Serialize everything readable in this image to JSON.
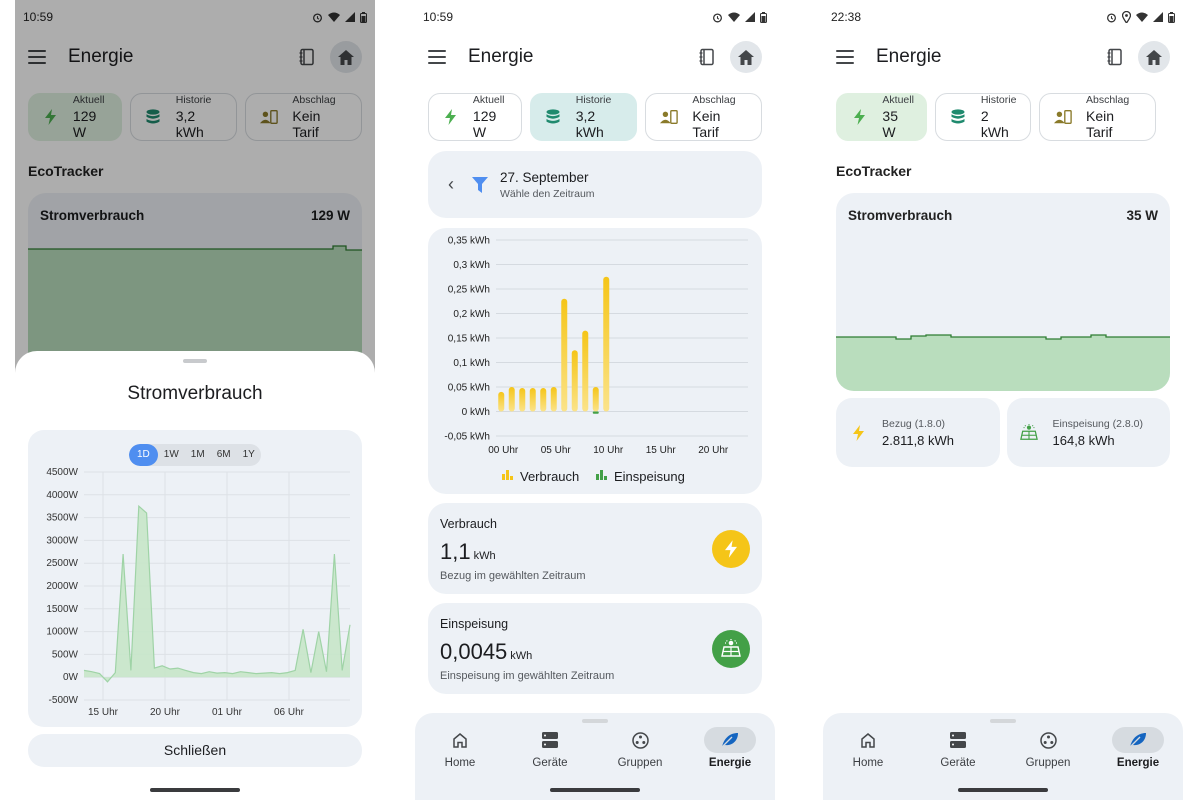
{
  "screens": [
    {
      "status": {
        "time": "10:59"
      },
      "app_title": "Energie",
      "chips": [
        {
          "label": "Aktuell",
          "value": "129 W"
        },
        {
          "label": "Historie",
          "value": "3,2 kWh"
        },
        {
          "label": "Abschlag",
          "value": "Kein Tarif"
        }
      ],
      "section": "EcoTracker",
      "card_title": "Stromverbrauch",
      "card_value": "129 W"
    },
    {
      "status": {
        "time": "10:59"
      },
      "app_title": "Energie",
      "chips": [
        {
          "label": "Aktuell",
          "value": "129 W"
        },
        {
          "label": "Historie",
          "value": "3,2 kWh"
        },
        {
          "label": "Abschlag",
          "value": "Kein Tarif"
        }
      ]
    },
    {
      "status": {
        "time": "22:38"
      },
      "app_title": "Energie",
      "chips": [
        {
          "label": "Aktuell",
          "value": "35 W"
        },
        {
          "label": "Historie",
          "value": "2 kWh"
        },
        {
          "label": "Abschlag",
          "value": "Kein Tarif"
        }
      ],
      "section": "EcoTracker",
      "card_title": "Stromverbrauch",
      "card_value": "35 W"
    }
  ],
  "sheet": {
    "title": "Stromverbrauch",
    "ranges": [
      "1D",
      "1W",
      "1M",
      "6M",
      "1Y"
    ],
    "selected_range": "1D",
    "close_label": "Schließen"
  },
  "history": {
    "date_title": "27. September",
    "date_sub": "Wähle den Zeitraum",
    "verbrauch": {
      "title": "Verbrauch",
      "value": "1,1",
      "unit": "kWh",
      "desc": "Bezug im gewählten Zeitraum"
    },
    "einspeisung": {
      "title": "Einspeisung",
      "value": "0,0045",
      "unit": "kWh",
      "desc": "Einspeisung im gewählten Zeitraum"
    }
  },
  "meters": {
    "bezug": {
      "label": "Bezug (1.8.0)",
      "value": "2.811,8 kWh"
    },
    "einspeisung": {
      "label": "Einspeisung (2.8.0)",
      "value": "164,8 kWh"
    }
  },
  "nav": [
    {
      "label": "Home",
      "icon": "home-icon"
    },
    {
      "label": "Geräte",
      "icon": "devices-icon"
    },
    {
      "label": "Gruppen",
      "icon": "groups-icon"
    },
    {
      "label": "Energie",
      "icon": "leaf-icon",
      "selected": true
    }
  ],
  "colors": {
    "accent_green": "#2e7d32",
    "chart_yellow": "#f5c518",
    "feed_green": "#43a047",
    "selected_blue": "#4f8ef0"
  },
  "chart_data": [
    {
      "type": "line",
      "title": "Stromverbrauch",
      "xlabel": "",
      "ylabel": "",
      "y_ticks": [
        "4500W",
        "4000W",
        "3500W",
        "3000W",
        "2500W",
        "2000W",
        "1500W",
        "1000W",
        "500W",
        "0W",
        "-500W"
      ],
      "x_ticks": [
        "15 Uhr",
        "20 Uhr",
        "01 Uhr",
        "06 Uhr"
      ],
      "ylim": [
        -500,
        4500
      ],
      "series": [
        {
          "values": [
            150,
            120,
            80,
            -100,
            100,
            2700,
            150,
            3750,
            3600,
            200,
            250,
            180,
            200,
            150,
            100,
            80,
            120,
            90,
            100,
            80,
            120,
            100,
            80,
            90,
            100,
            80,
            100,
            150,
            1050,
            100,
            1000,
            120,
            2700,
            150,
            1150
          ]
        }
      ]
    },
    {
      "type": "bar",
      "y_ticks": [
        "0,35 kWh",
        "0,3 kWh",
        "0,25 kWh",
        "0,2 kWh",
        "0,15 kWh",
        "0,1 kWh",
        "0,05 kWh",
        "0 kWh",
        "-0,05 kWh"
      ],
      "x_ticks": [
        "00 Uhr",
        "05 Uhr",
        "10 Uhr",
        "15 Uhr",
        "20 Uhr"
      ],
      "ylim": [
        -0.05,
        0.35
      ],
      "categories": [
        "0",
        "1",
        "2",
        "3",
        "4",
        "5",
        "6",
        "7",
        "8",
        "9",
        "10",
        "11",
        "12",
        "13",
        "14",
        "15",
        "16",
        "17",
        "18",
        "19",
        "20",
        "21",
        "22",
        "23"
      ],
      "series": [
        {
          "name": "Verbrauch",
          "values": [
            0.04,
            0.05,
            0.048,
            0.048,
            0.048,
            0.05,
            0.23,
            0.125,
            0.165,
            0.05,
            0.275,
            0,
            0,
            0,
            0,
            0,
            0,
            0,
            0,
            0,
            0,
            0,
            0,
            0
          ]
        },
        {
          "name": "Einspeisung",
          "values": [
            0,
            0,
            0,
            0,
            0,
            0,
            0,
            0,
            0,
            -0.0045,
            0,
            0,
            0,
            0,
            0,
            0,
            0,
            0,
            0,
            0,
            0,
            0,
            0,
            0
          ]
        }
      ]
    }
  ]
}
